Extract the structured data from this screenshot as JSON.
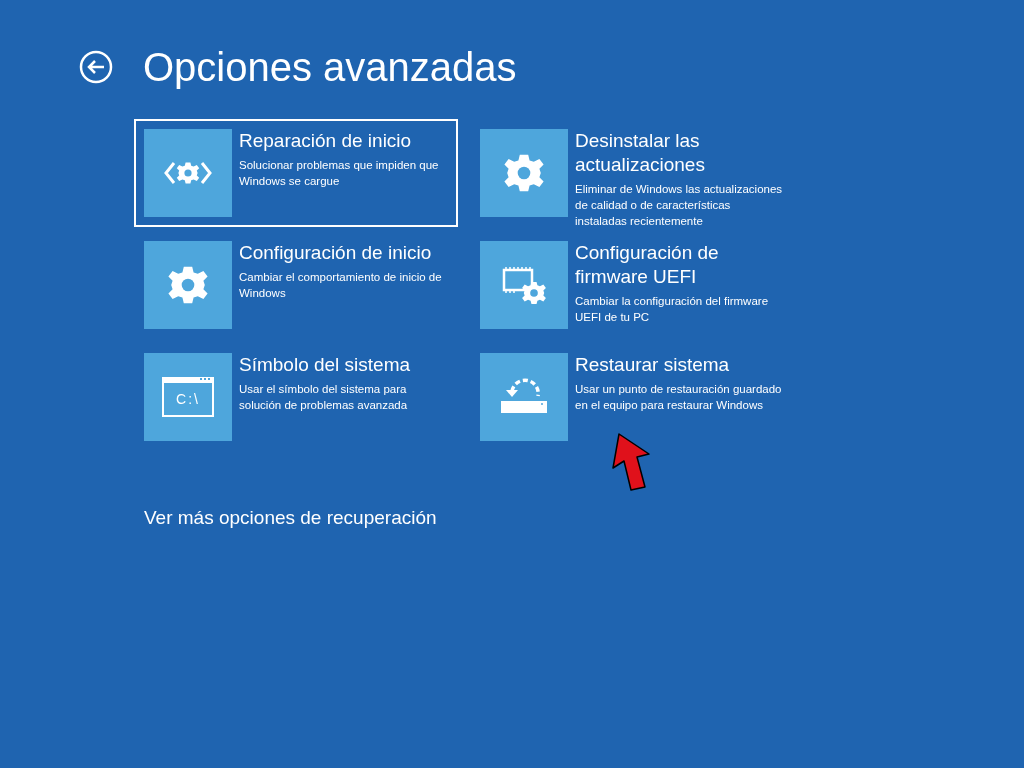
{
  "header": {
    "title": "Opciones avanzadas"
  },
  "options": [
    {
      "title": "Reparación de inicio",
      "description": "Solucionar problemas que impiden que Windows se cargue",
      "selected": true
    },
    {
      "title": "Desinstalar las actualizaciones",
      "description": "Eliminar de Windows las actualizaciones de calidad o de características instaladas recientemente",
      "selected": false
    },
    {
      "title": "Configuración de inicio",
      "description": "Cambiar el comportamiento de inicio de Windows",
      "selected": false
    },
    {
      "title": "Configuración de firmware UEFI",
      "description": "Cambiar la configuración del firmware UEFI de tu PC",
      "selected": false
    },
    {
      "title": "Símbolo del sistema",
      "description": "Usar el símbolo del sistema para solución de problemas avanzada",
      "icon_text": "C:\\",
      "selected": false
    },
    {
      "title": "Restaurar sistema",
      "description": "Usar un punto de restauración guardado en el equipo para restaurar Windows",
      "selected": false
    }
  ],
  "more_link": "Ver más opciones de recuperación"
}
